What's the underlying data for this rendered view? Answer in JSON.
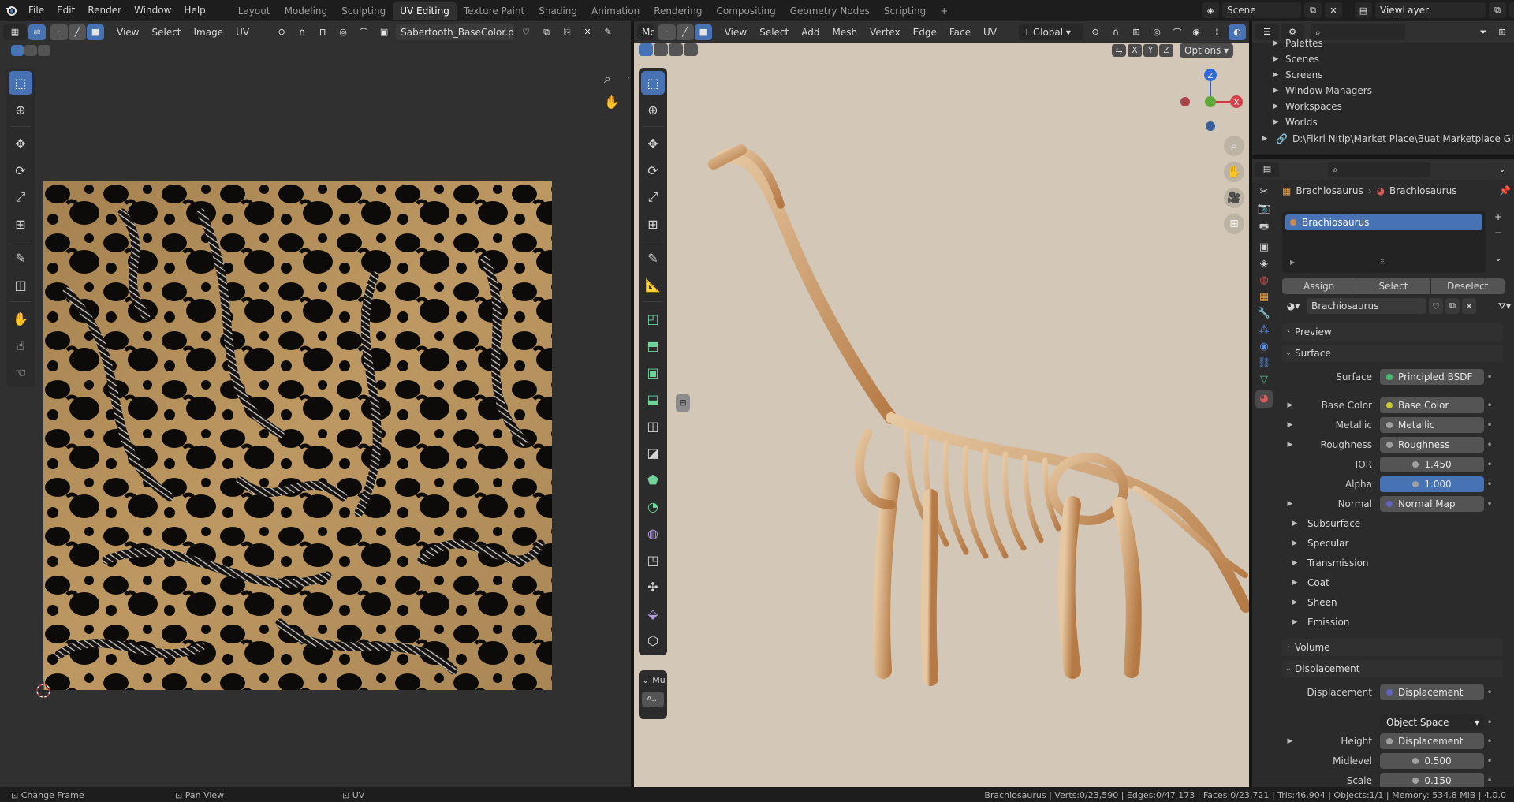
{
  "topbar": {
    "menus": [
      "File",
      "Edit",
      "Render",
      "Window",
      "Help"
    ],
    "workspaces": [
      "Layout",
      "Modeling",
      "Sculpting",
      "UV Editing",
      "Texture Paint",
      "Shading",
      "Animation",
      "Rendering",
      "Compositing",
      "Geometry Nodes",
      "Scripting"
    ],
    "active_workspace": "UV Editing",
    "add_label": "+",
    "scene": "Scene",
    "view_layer": "ViewLayer"
  },
  "uv_editor": {
    "menus": [
      "View",
      "Select",
      "Image",
      "UV"
    ],
    "image_name": "Sabertooth_BaseColor.png"
  },
  "viewport": {
    "mode": "Mode",
    "menus": [
      "View",
      "Select",
      "Add",
      "Mesh",
      "Vertex",
      "Edge",
      "Face",
      "UV"
    ],
    "orientation": "Global",
    "options_label": "Options",
    "axis_labels": [
      "X",
      "Y",
      "Z"
    ],
    "gizmo": {
      "x": "X",
      "y": "Y",
      "z": "Z"
    },
    "last_op_header": "Mu",
    "last_op_button": "A..."
  },
  "outliner": {
    "items": [
      "Palettes",
      "Scenes",
      "Screens",
      "Window Managers",
      "Workspaces",
      "Worlds"
    ],
    "path": "D:\\Fikri Nitip\\Market Place\\Buat Marketplace Global\\Re"
  },
  "properties": {
    "breadcrumb": [
      "Brachiosaurus",
      "Brachiosaurus"
    ],
    "slot_name": "Brachiosaurus",
    "assign": "Assign",
    "select": "Select",
    "deselect": "Deselect",
    "material_name": "Brachiosaurus",
    "sections": {
      "preview": "Preview",
      "surface": "Surface",
      "volume": "Volume",
      "displacement": "Displacement"
    },
    "surface_rows": [
      {
        "label": "Surface",
        "value": "Principled BSDF",
        "dot": "#3fbf6a"
      },
      {
        "label": "Base Color",
        "value": "Base Color",
        "dot": "#c7c729"
      },
      {
        "label": "Metallic",
        "value": "Metallic",
        "dot": "#a1a1a1"
      },
      {
        "label": "Roughness",
        "value": "Roughness",
        "dot": "#a1a1a1"
      },
      {
        "label": "IOR",
        "value": "1.450",
        "dot": "#a1a1a1"
      },
      {
        "label": "Alpha",
        "value": "1.000",
        "dot": "#a1a1a1"
      },
      {
        "label": "Normal",
        "value": "Normal Map",
        "dot": "#6363c7"
      }
    ],
    "collapsed": [
      "Subsurface",
      "Specular",
      "Transmission",
      "Coat",
      "Sheen",
      "Emission"
    ],
    "displacement_rows": [
      {
        "label": "Displacement",
        "value": "Displacement",
        "dot": "#6363c7"
      },
      {
        "label": "",
        "value": "Object Space",
        "dot": ""
      },
      {
        "label": "Height",
        "value": "Displacement",
        "dot": "#a1a1a1"
      },
      {
        "label": "Midlevel",
        "value": "0.500",
        "dot": "#a1a1a1"
      },
      {
        "label": "Scale",
        "value": "0.150",
        "dot": "#a1a1a1"
      }
    ],
    "alpha_fraction": 1.0
  },
  "status": {
    "left": [
      "Change Frame",
      "Pan View",
      "UV"
    ],
    "right": "Brachiosaurus | Verts:0/23,590 | Edges:0/47,173 | Faces:0/23,721 | Tris:46,904 | Objects:1/1 | Memory: 534.8 MiB | 4.0.0"
  },
  "colors": {
    "accent": "#4772b3",
    "panel": "#303030",
    "viewport_bg": "#d3c7b7",
    "bone": "#c9925c"
  }
}
